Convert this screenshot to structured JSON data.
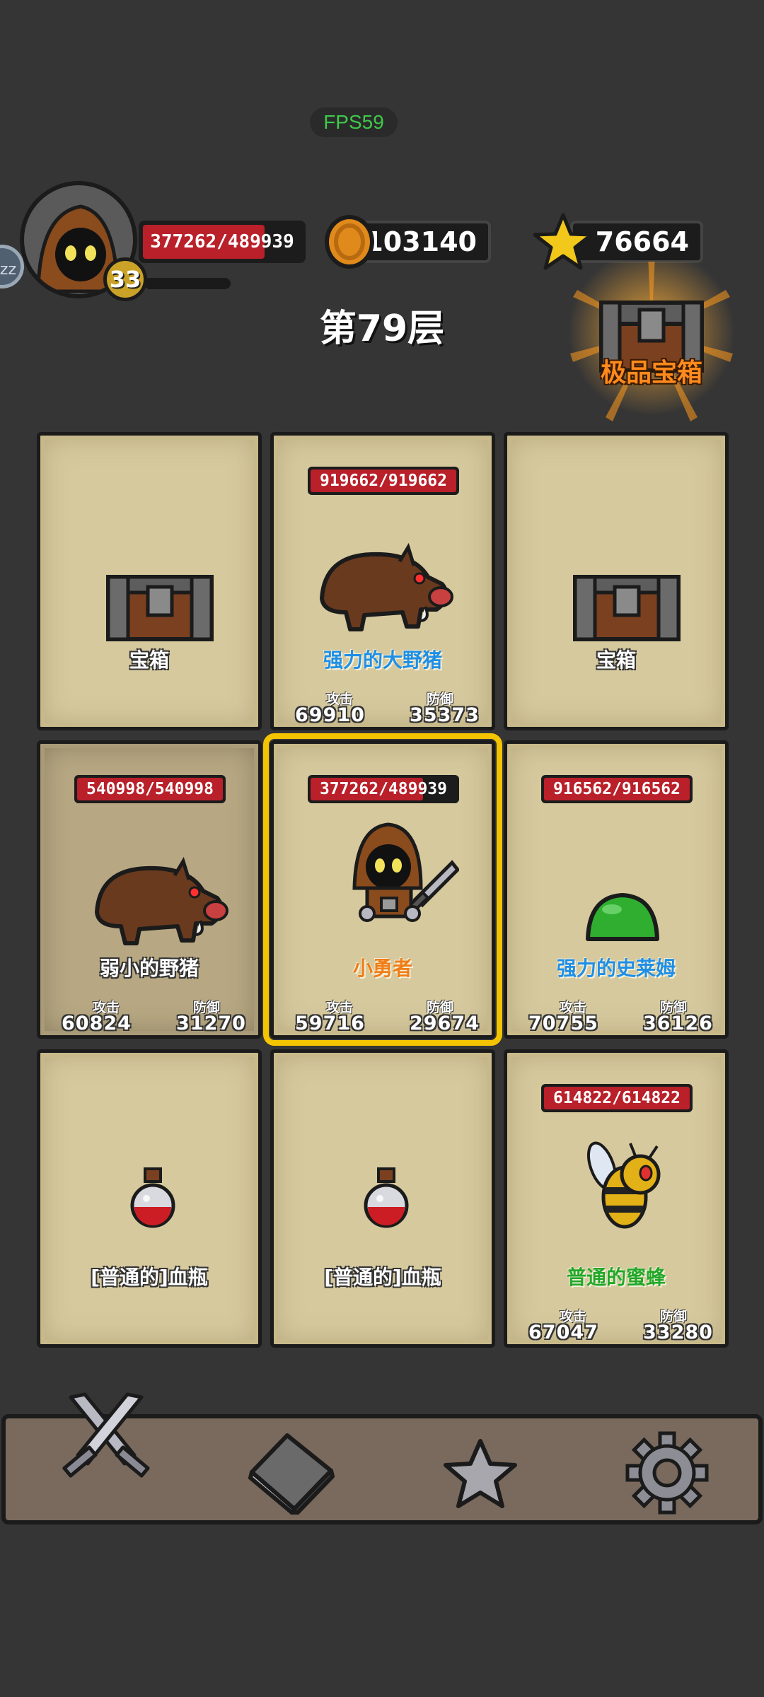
{
  "hud": {
    "fps": "FPS59",
    "side_button": "zz",
    "player_hp": "377262/489939",
    "player_hp_fraction": 0.77,
    "level": "33",
    "xp_fraction": 0.0,
    "coins": "103140",
    "stars": "76664",
    "floor_title": "第79层",
    "premium_chest_label": "极品宝箱"
  },
  "colors": {
    "background": "#353535",
    "card": "#d6c99e",
    "hp_red": "#b9202a",
    "selected_outline": "#f5c400",
    "fps_green": "#3fc84a"
  },
  "cards": [
    {
      "type": "chest",
      "name": "宝箱"
    },
    {
      "type": "enemy",
      "name": "强力的大野猪",
      "hp": "919662/919662",
      "atk_label": "攻击",
      "atk": "69910",
      "def_label": "防御",
      "def": "35373"
    },
    {
      "type": "chest",
      "name": "宝箱"
    },
    {
      "type": "enemy",
      "name": "弱小的野猪",
      "hp": "540998/540998",
      "atk_label": "攻击",
      "atk": "60824",
      "def_label": "防御",
      "def": "31270"
    },
    {
      "type": "hero",
      "name": "小勇者",
      "hp": "377262/489939",
      "atk_label": "攻击",
      "atk": "59716",
      "def_label": "防御",
      "def": "29674"
    },
    {
      "type": "enemy",
      "name": "强力的史莱姆",
      "hp": "916562/916562",
      "atk_label": "攻击",
      "atk": "70755",
      "def_label": "防御",
      "def": "36126"
    },
    {
      "type": "potion",
      "name": "[普通的]血瓶"
    },
    {
      "type": "potion",
      "name": "[普通的]血瓶"
    },
    {
      "type": "enemy",
      "name": "普通的蜜蜂",
      "hp": "614822/614822",
      "atk_label": "攻击",
      "atk": "67047",
      "def_label": "防御",
      "def": "33280"
    }
  ],
  "nav": {
    "items": [
      {
        "icon": "crossed-swords-icon"
      },
      {
        "icon": "book-icon"
      },
      {
        "icon": "star-icon"
      },
      {
        "icon": "gear-icon"
      }
    ]
  }
}
